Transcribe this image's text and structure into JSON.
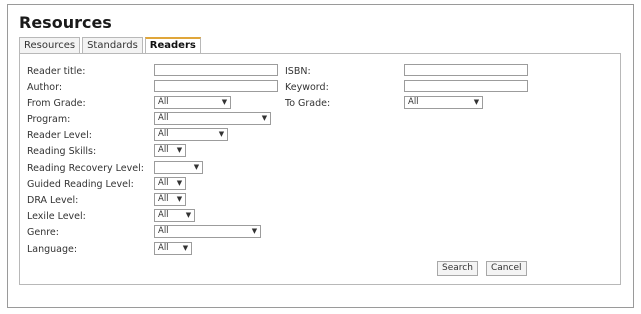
{
  "title": "Resources",
  "tabs": [
    "Resources",
    "Standards",
    "Readers"
  ],
  "active_tab": "Readers",
  "fields": {
    "reader_title": {
      "label": "Reader title:",
      "value": ""
    },
    "isbn": {
      "label": "ISBN:",
      "value": ""
    },
    "author": {
      "label": "Author:",
      "value": ""
    },
    "keyword": {
      "label": "Keyword:",
      "value": ""
    },
    "from_grade": {
      "label": "From Grade:",
      "value": "All"
    },
    "to_grade": {
      "label": "To Grade:",
      "value": "All"
    },
    "program": {
      "label": "Program:",
      "value": "All"
    },
    "reader_level": {
      "label": "Reader Level:",
      "value": "All"
    },
    "reading_skills": {
      "label": "Reading Skills:",
      "value": "All"
    },
    "reading_recovery_level": {
      "label": "Reading Recovery Level:",
      "value": ""
    },
    "guided_reading_level": {
      "label": "Guided Reading Level:",
      "value": "All"
    },
    "dra_level": {
      "label": "DRA Level:",
      "value": "All"
    },
    "lexile_level": {
      "label": "Lexile Level:",
      "value": "All"
    },
    "genre": {
      "label": "Genre:",
      "value": "All"
    },
    "language": {
      "label": "Language:",
      "value": "All"
    }
  },
  "buttons": {
    "search": "Search",
    "cancel": "Cancel"
  },
  "icons": {
    "dropdown": "chevron-down-icon"
  },
  "colors": {
    "active_tab_accent": "#e0a63a",
    "border": "#9c9c9c"
  }
}
